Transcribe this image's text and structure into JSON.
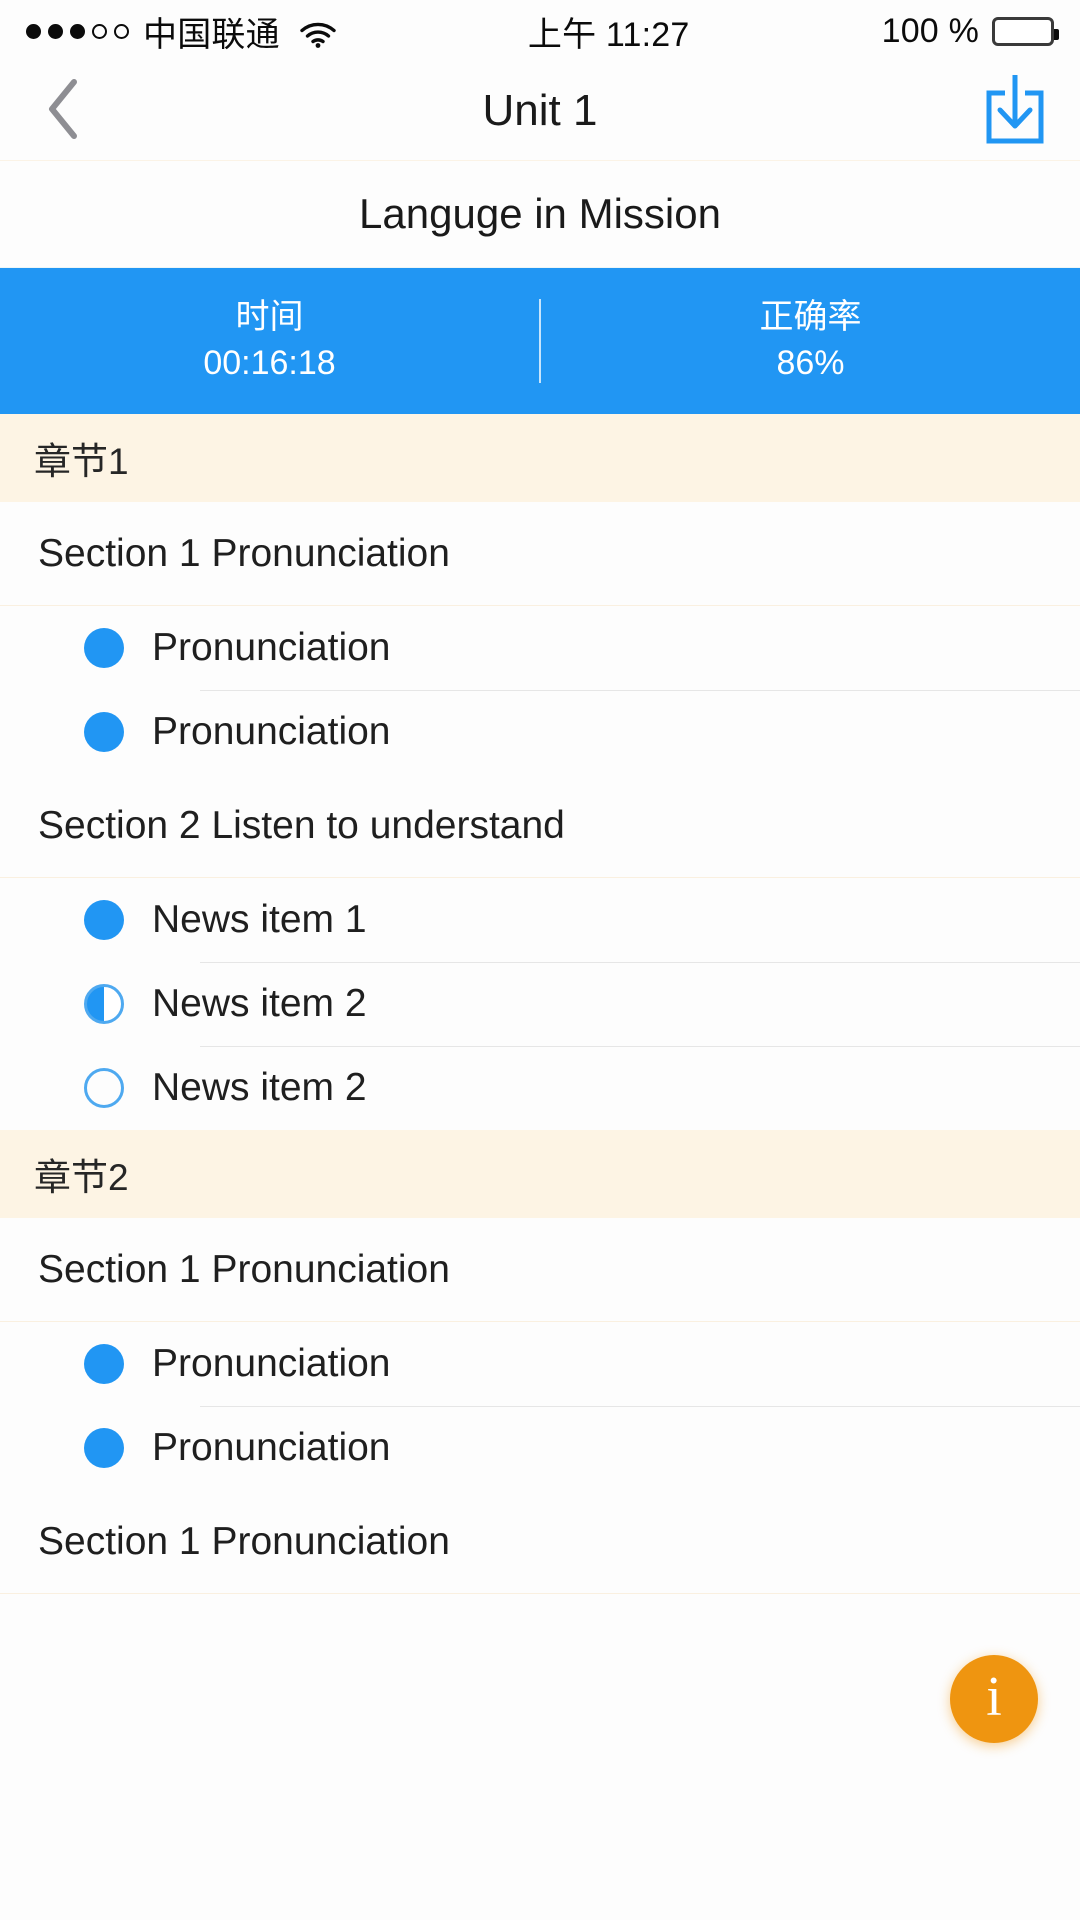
{
  "status_bar": {
    "signal_dots_filled": 3,
    "signal_dots_total": 5,
    "carrier": "中国联通",
    "wifi_icon": "wifi-icon",
    "time": "上午 11:27",
    "battery_percent": "100 %",
    "battery_level": 100
  },
  "nav": {
    "back_icon": "chevron-left-icon",
    "title": "Unit 1",
    "download_icon": "download-icon"
  },
  "subtitle": "Languge in Mission",
  "stats": {
    "time": {
      "label": "时间",
      "value": "00:16:18"
    },
    "accuracy": {
      "label": "正确率",
      "value": "86%"
    }
  },
  "colors": {
    "accent_blue": "#2196f3",
    "chapter_bg": "#fdf4e4",
    "fab_orange": "#ef9510",
    "page_bg": "#fdfdfd"
  },
  "list": [
    {
      "type": "chapter",
      "label": "章节1"
    },
    {
      "type": "section",
      "label": "Section 1 Pronunciation"
    },
    {
      "type": "subitem",
      "label": "Pronunciation",
      "state": "full"
    },
    {
      "type": "subitem",
      "label": "Pronunciation",
      "state": "full"
    },
    {
      "type": "section",
      "label": "Section 2 Listen to understand"
    },
    {
      "type": "subitem",
      "label": "News item 1",
      "state": "full"
    },
    {
      "type": "subitem",
      "label": "News item 2",
      "state": "half"
    },
    {
      "type": "subitem",
      "label": "News item 2",
      "state": "empty"
    },
    {
      "type": "chapter",
      "label": "章节2"
    },
    {
      "type": "section",
      "label": "Section 1 Pronunciation"
    },
    {
      "type": "subitem",
      "label": "Pronunciation",
      "state": "full"
    },
    {
      "type": "subitem",
      "label": "Pronunciation",
      "state": "full"
    },
    {
      "type": "section",
      "label": "Section 1 Pronunciation"
    }
  ],
  "fab": {
    "icon": "info-icon",
    "label": "i"
  }
}
